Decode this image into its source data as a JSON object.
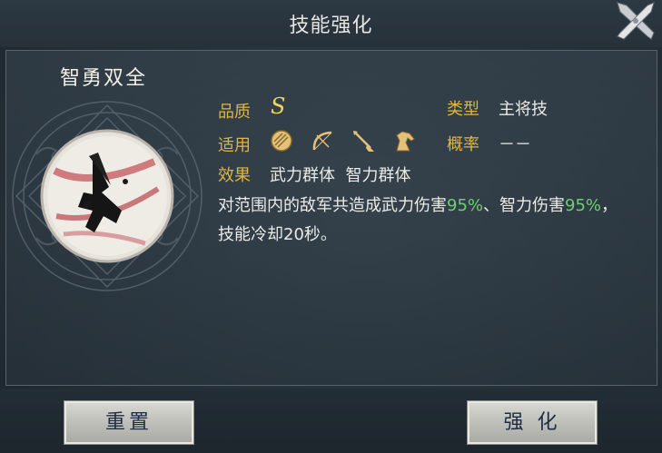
{
  "header": {
    "title": "技能强化"
  },
  "skill": {
    "name": "智勇双全",
    "quality_label": "品质",
    "quality_value": "S",
    "type_label": "类型",
    "type_value": "主将技",
    "applies_label": "适用",
    "applies_icons": [
      "shield-icon",
      "bow-icon",
      "spear-icon",
      "cavalry-horse-icon"
    ],
    "rate_label": "概率",
    "rate_value": "－－",
    "effect_label": "效果",
    "effect_tags": "武力群体  智力群体",
    "description": {
      "part1": "对范围内的敌军共造成武力伤害",
      "pct1": "95%",
      "part2": "、智力伤害",
      "pct2": "95%",
      "part3": "，技能冷却20秒。"
    }
  },
  "buttons": {
    "reset": "重置",
    "strengthen": "强 化"
  },
  "colors": {
    "label_gold": "#e0b640",
    "highlight_green": "#6fcf74",
    "button_text": "#1e2b44"
  }
}
